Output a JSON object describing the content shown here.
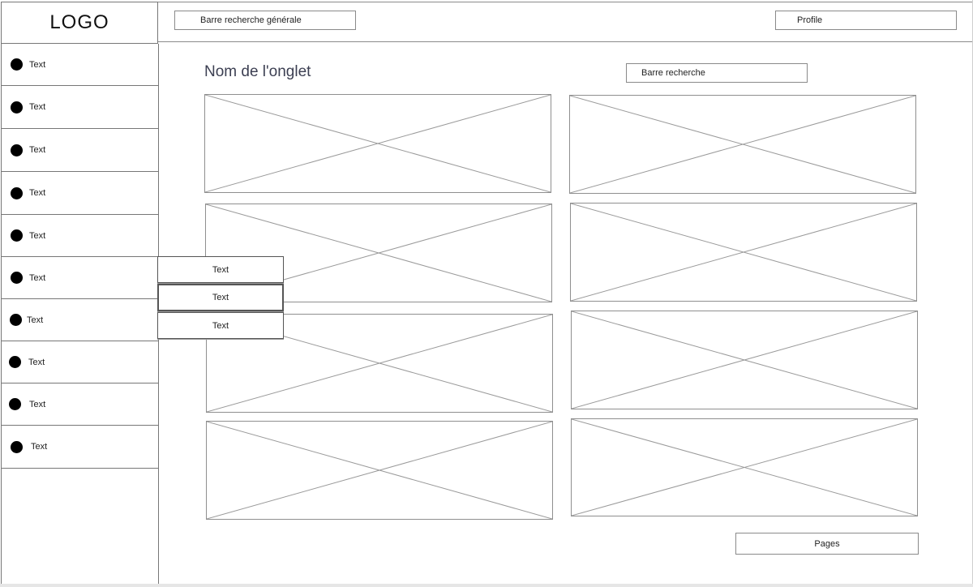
{
  "header": {
    "logo": "LOGO",
    "global_search": "Barre recherche générale",
    "profile": "Profile"
  },
  "sidebar": {
    "items": [
      {
        "label": "Text"
      },
      {
        "label": "Text"
      },
      {
        "label": "Text"
      },
      {
        "label": "Text"
      },
      {
        "label": "Text"
      },
      {
        "label": "Text"
      },
      {
        "label": "Text"
      },
      {
        "label": "Text"
      },
      {
        "label": "Text"
      },
      {
        "label": "Text"
      }
    ]
  },
  "submenu": {
    "items": [
      {
        "label": "Text"
      },
      {
        "label": "Text"
      },
      {
        "label": "Text"
      }
    ]
  },
  "main": {
    "tab_title": "Nom de l'onglet",
    "search": "Barre recherche",
    "pages_button": "Pages",
    "placeholder_count": 8
  }
}
